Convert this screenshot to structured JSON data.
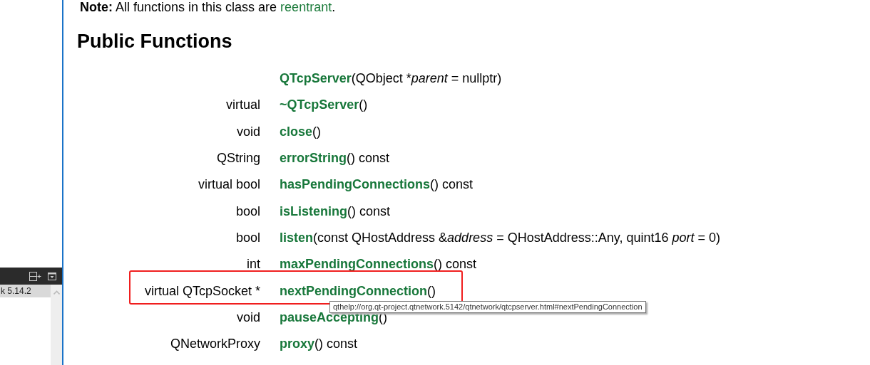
{
  "sidebar": {
    "header_buttons": [
      {
        "kind": "split"
      },
      {
        "kind": "dropdown"
      }
    ],
    "items": [
      {
        "label": "k 5.14.2",
        "selected": true
      }
    ]
  },
  "note": {
    "label": "Note:",
    "text": "All functions in this class are",
    "link": "reentrant",
    "end": "."
  },
  "heading": "Public Functions",
  "rows": [
    {
      "type": "",
      "highlighted": false,
      "signature": [
        {
          "kind": "name",
          "text": "QTcpServer"
        },
        {
          "kind": "plain",
          "text": "(QObject *"
        },
        {
          "kind": "param",
          "text": "parent"
        },
        {
          "kind": "plain",
          "text": " = nullptr)"
        }
      ]
    },
    {
      "type": "virtual",
      "highlighted": false,
      "signature": [
        {
          "kind": "name",
          "text": "~QTcpServer"
        },
        {
          "kind": "plain",
          "text": "()"
        }
      ]
    },
    {
      "type": "void",
      "highlighted": false,
      "signature": [
        {
          "kind": "name",
          "text": "close"
        },
        {
          "kind": "plain",
          "text": "()"
        }
      ]
    },
    {
      "type": "QString",
      "highlighted": false,
      "signature": [
        {
          "kind": "name",
          "text": "errorString"
        },
        {
          "kind": "plain",
          "text": "() const"
        }
      ]
    },
    {
      "type": "virtual bool",
      "highlighted": false,
      "signature": [
        {
          "kind": "name",
          "text": "hasPendingConnections"
        },
        {
          "kind": "plain",
          "text": "() const"
        }
      ]
    },
    {
      "type": "bool",
      "highlighted": false,
      "signature": [
        {
          "kind": "name",
          "text": "isListening"
        },
        {
          "kind": "plain",
          "text": "() const"
        }
      ]
    },
    {
      "type": "bool",
      "highlighted": false,
      "signature": [
        {
          "kind": "name",
          "text": "listen"
        },
        {
          "kind": "plain",
          "text": "(const QHostAddress &"
        },
        {
          "kind": "param",
          "text": "address"
        },
        {
          "kind": "plain",
          "text": " = QHostAddress::Any, quint16 "
        },
        {
          "kind": "param",
          "text": "port"
        },
        {
          "kind": "plain",
          "text": " = 0)"
        }
      ]
    },
    {
      "type": "int",
      "highlighted": false,
      "signature": [
        {
          "kind": "name",
          "text": "maxPendingConnections"
        },
        {
          "kind": "plain",
          "text": "() const"
        }
      ]
    },
    {
      "type": "virtual QTcpSocket *",
      "highlighted": true,
      "signature": [
        {
          "kind": "name",
          "text": "nextPendingConnection"
        },
        {
          "kind": "plain",
          "text": "()"
        }
      ]
    },
    {
      "type": "void",
      "highlighted": false,
      "signature": [
        {
          "kind": "name",
          "text": "pauseAccepting"
        },
        {
          "kind": "plain",
          "text": "()"
        }
      ]
    },
    {
      "type": "QNetworkProxy",
      "highlighted": false,
      "signature": [
        {
          "kind": "name",
          "text": "proxy"
        },
        {
          "kind": "plain",
          "text": "() const"
        }
      ]
    }
  ],
  "tooltip": {
    "text": "qthelp://org.qt-project.qtnetwork.5142/qtnetwork/qtcpserver.html#nextPendingConnection"
  }
}
